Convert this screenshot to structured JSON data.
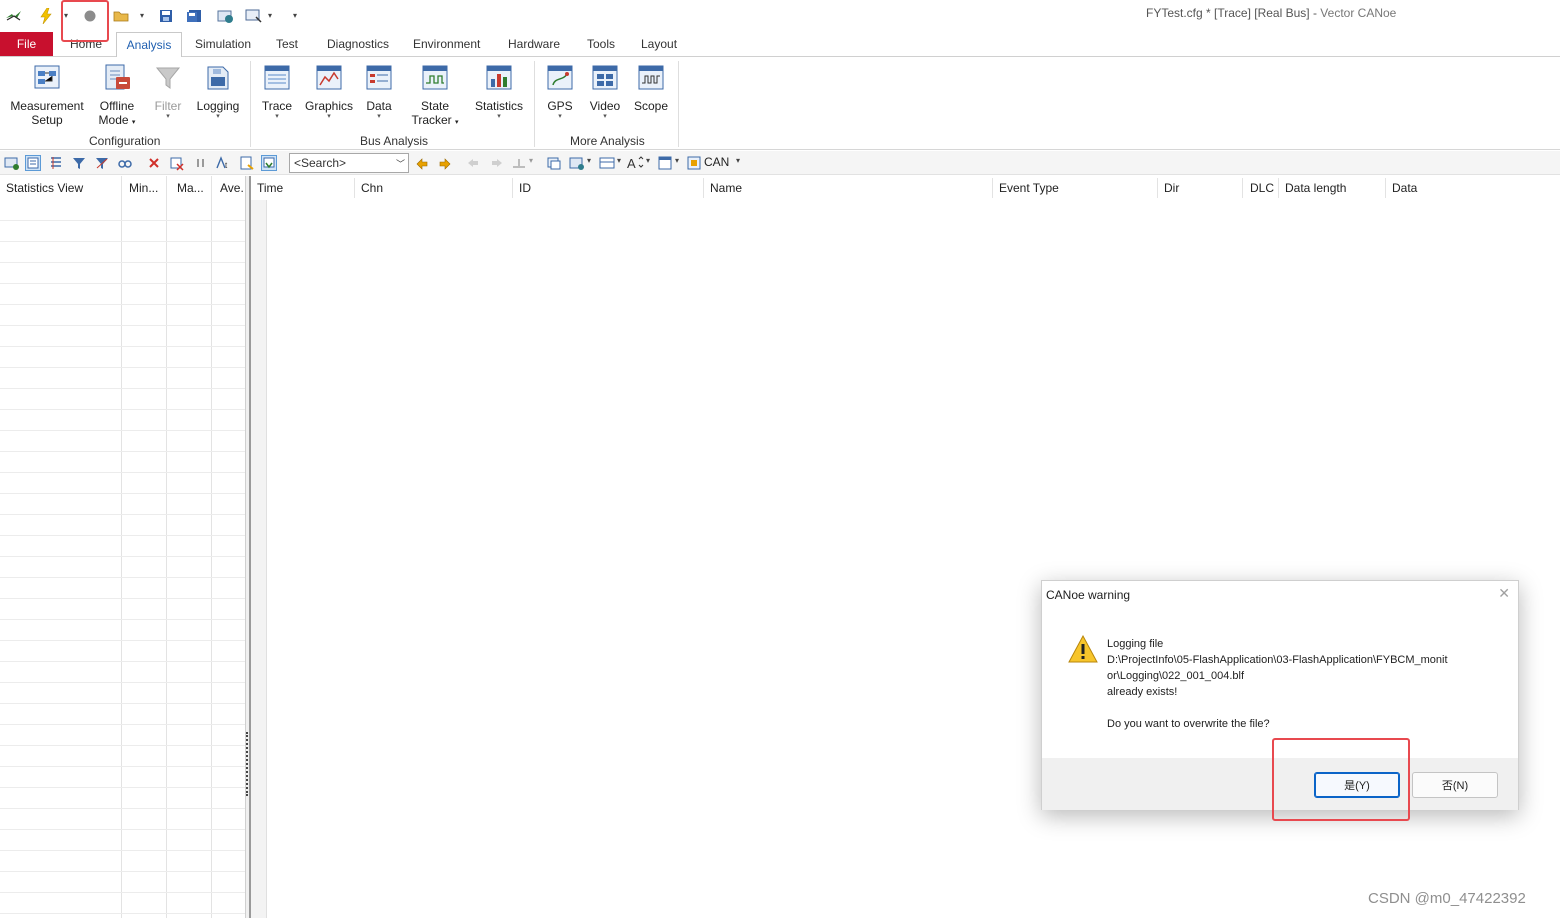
{
  "window": {
    "title_doc": "FYTest.cfg * [Trace] [Real Bus]",
    "title_sep": " - ",
    "title_app": "Vector CANoe"
  },
  "ribbon_tabs": {
    "file": "File",
    "home": "Home",
    "analysis": "Analysis",
    "simulation": "Simulation",
    "test": "Test",
    "diagnostics": "Diagnostics",
    "environment": "Environment",
    "hardware": "Hardware",
    "tools": "Tools",
    "layout": "Layout"
  },
  "ribbon": {
    "configuration": {
      "label": "Configuration",
      "measurement_setup": [
        "Measurement",
        "Setup"
      ],
      "offline_mode": [
        "Offline",
        "Mode"
      ],
      "filter": "Filter",
      "logging": "Logging"
    },
    "bus_analysis": {
      "label": "Bus Analysis",
      "trace": "Trace",
      "graphics": "Graphics",
      "data": "Data",
      "state_tracker": [
        "State",
        "Tracker"
      ],
      "statistics": "Statistics"
    },
    "more_analysis": {
      "label": "More Analysis",
      "gps": "GPS",
      "video": "Video",
      "scope": "Scope"
    }
  },
  "toolbar2": {
    "search_value": "<Search>",
    "bus_selector": "CAN"
  },
  "statistics_pane": {
    "columns": [
      "Statistics View",
      "Min...",
      "Ma...",
      "Ave."
    ]
  },
  "trace": {
    "columns": [
      "Time",
      "Chn",
      "ID",
      "Name",
      "Event Type",
      "Dir",
      "DLC",
      "Data length",
      "Data"
    ]
  },
  "dialog": {
    "title": "CANoe warning",
    "close": "✕",
    "line1": "Logging file",
    "line2": "D:\\ProjectInfo\\05-FlashApplication\\03-FlashApplication\\FYBCM_monit",
    "line3": "or\\Logging\\022_001_004.blf",
    "line4": "already exists!",
    "line5": "Do you want to overwrite the file?",
    "yes_button": "是(Y)",
    "no_button": "否(N)"
  },
  "highlight_color": "#e8494f",
  "accent_color": "#c8102e",
  "watermark": "CSDN @m0_47422392"
}
